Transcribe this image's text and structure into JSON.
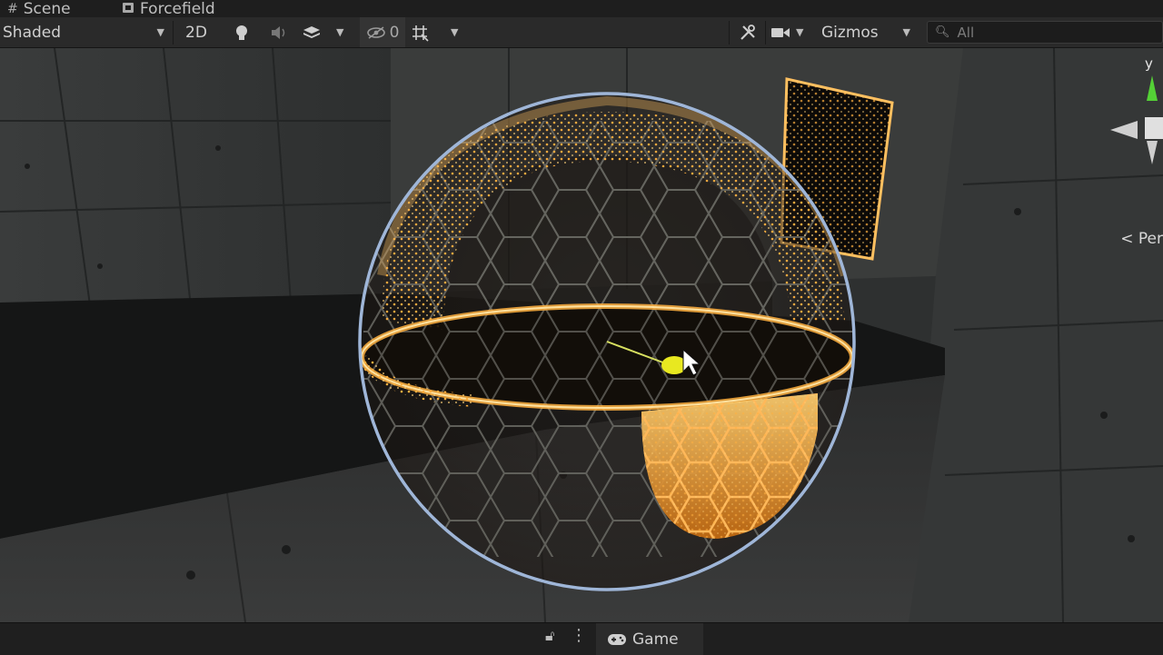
{
  "tabs": [
    {
      "label": "Scene",
      "icon": "hash-icon"
    },
    {
      "label": "Forcefield",
      "icon": "cube-icon"
    }
  ],
  "toolbar": {
    "shading_mode": "Shaded",
    "mode_2d": "2D",
    "hidden_count": "0",
    "gizmos": "Gizmos",
    "search_placeholder": "All"
  },
  "viewport": {
    "axis_label": "y",
    "projection_label": "< Per"
  },
  "bottom": {
    "game_tab": "Game"
  },
  "colors": {
    "glow": "#ffb040",
    "shell_outline": "#9fb6d8",
    "axis_y": "#54d136"
  }
}
